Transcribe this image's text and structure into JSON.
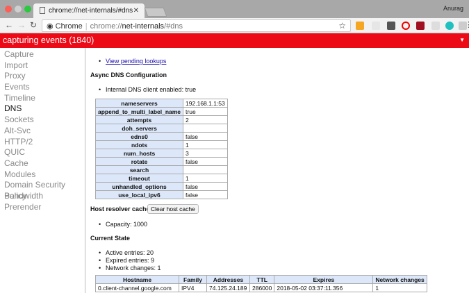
{
  "browser": {
    "tab_title": "chrome://net-internals/#dns",
    "user": "Anurag",
    "omnibox_label": "Chrome",
    "url_scheme": "chrome://",
    "url_host": "net-internals",
    "url_path": "/#dns"
  },
  "capture_bar": {
    "text": "capturing events (1840)"
  },
  "sidebar": {
    "items": [
      {
        "label": "Capture"
      },
      {
        "label": "Import"
      },
      {
        "label": "Proxy"
      },
      {
        "label": "Events"
      },
      {
        "label": "Timeline"
      },
      {
        "label": "DNS"
      },
      {
        "label": "Sockets"
      },
      {
        "label": "Alt-Svc"
      },
      {
        "label": "HTTP/2"
      },
      {
        "label": "QUIC"
      },
      {
        "label": "Cache"
      },
      {
        "label": "Modules"
      },
      {
        "label": "Domain Security Policy"
      },
      {
        "label": "Bandwidth"
      },
      {
        "label": "Prerender"
      }
    ],
    "selected": "DNS"
  },
  "main": {
    "pending_link": "View pending lookups",
    "async_title": "Async DNS Configuration",
    "internal_client": "Internal DNS client enabled: true",
    "config": [
      [
        "nameservers",
        "192.168.1.1:53"
      ],
      [
        "append_to_multi_label_name",
        "true"
      ],
      [
        "attempts",
        "2"
      ],
      [
        "doh_servers",
        ""
      ],
      [
        "edns0",
        "false"
      ],
      [
        "ndots",
        "1"
      ],
      [
        "num_hosts",
        "3"
      ],
      [
        "rotate",
        "false"
      ],
      [
        "search",
        ""
      ],
      [
        "timeout",
        "1"
      ],
      [
        "unhandled_options",
        "false"
      ],
      [
        "use_local_ipv6",
        "false"
      ]
    ],
    "host_cache_title": "Host resolver cache",
    "clear_button": "Clear host cache",
    "capacity": "Capacity: 1000",
    "current_state_title": "Current State",
    "state": [
      "Active entries: 20",
      "Expired entries: 9",
      "Network changes: 1"
    ],
    "cache_headers": [
      "Hostname",
      "Family",
      "Addresses",
      "TTL",
      "Expires",
      "Network changes"
    ],
    "cache_rows": [
      [
        "0.client-channel.google.com",
        "IPV4",
        "74.125.24.189",
        "286000",
        "2018-05-02 03:37:11.356",
        "1"
      ]
    ]
  }
}
